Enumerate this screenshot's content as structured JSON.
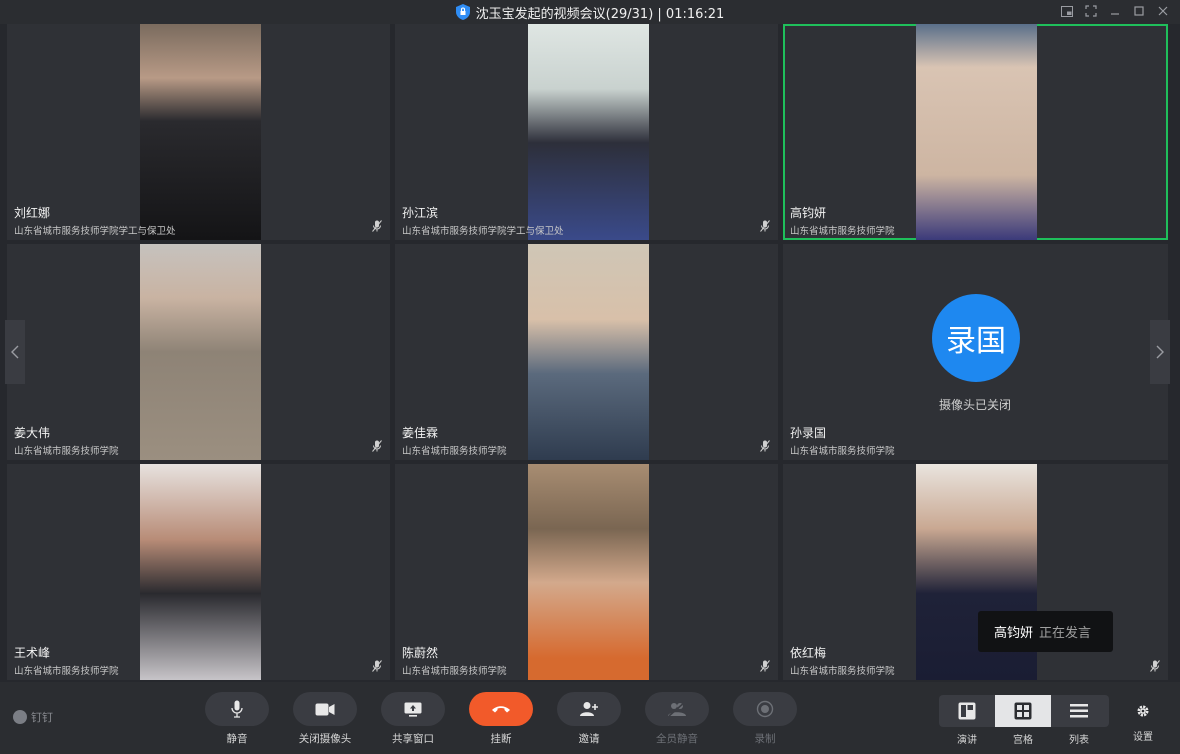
{
  "window": {
    "title": "沈玉宝发起的视频会议(29/31) | 01:16:21"
  },
  "participants": [
    {
      "name": "刘红娜",
      "org": "山东省城市服务技师学院学工与保卫处",
      "active": false
    },
    {
      "name": "孙江滨",
      "org": "山东省城市服务技师学院学工与保卫处",
      "active": false
    },
    {
      "name": "高钧妍",
      "org": "山东省城市服务技师学院",
      "active": true
    },
    {
      "name": "姜大伟",
      "org": "山东省城市服务技师学院",
      "active": false
    },
    {
      "name": "姜佳霖",
      "org": "山东省城市服务技师学院",
      "active": false
    },
    {
      "name": "孙录国",
      "org": "山东省城市服务技师学院",
      "active": false,
      "avatar_text": "录国",
      "camera_status": "摄像头已关闭"
    },
    {
      "name": "王术峰",
      "org": "山东省城市服务技师学院",
      "active": false
    },
    {
      "name": "陈蔚然",
      "org": "山东省城市服务技师学院",
      "active": false
    },
    {
      "name": "依红梅",
      "org": "山东省城市服务技师学院",
      "active": false
    }
  ],
  "speaking_toast": {
    "name": "高钧妍",
    "status": "正在发言"
  },
  "brand": {
    "label": "钉钉"
  },
  "toolbar": {
    "mute": "静音",
    "camera_off": "关闭摄像头",
    "share_window": "共享窗口",
    "hangup": "挂断",
    "invite": "邀请",
    "mute_all": "全员静音",
    "record": "录制"
  },
  "views": {
    "speaker": "演讲",
    "grid": "宫格",
    "list": "列表",
    "selected": "grid"
  },
  "settings": {
    "label": "设置"
  },
  "colors": {
    "accent_blue": "#1e88f0",
    "hangup_red": "#f25a2a",
    "active_speaker_green": "#1fbf5b"
  }
}
